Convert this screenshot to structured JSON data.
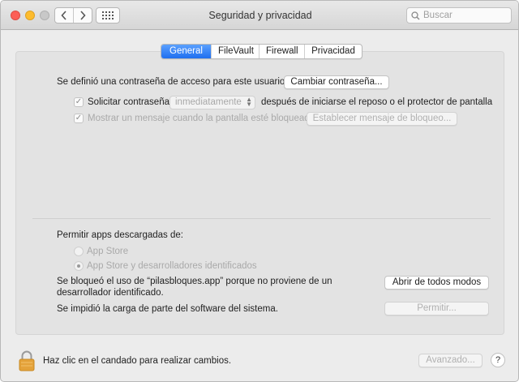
{
  "window": {
    "title": "Seguridad y privacidad",
    "search_placeholder": "Buscar"
  },
  "tabs": [
    {
      "label": "General",
      "active": true
    },
    {
      "label": "FileVault",
      "active": false
    },
    {
      "label": "Firewall",
      "active": false
    },
    {
      "label": "Privacidad",
      "active": false
    }
  ],
  "general": {
    "password_set_text": "Se definió una contraseña de acceso para este usuario",
    "change_password_button": "Cambiar contraseña...",
    "require_password": {
      "label": "Solicitar contraseña",
      "checked": true,
      "select_value": "inmediatamente",
      "suffix": "después de iniciarse el reposo o el protector de pantalla"
    },
    "show_message": {
      "label": "Mostrar un mensaje cuando la pantalla esté bloqueada",
      "checked": true,
      "button": "Establecer mensaje de bloqueo..."
    }
  },
  "downloads": {
    "heading": "Permitir apps descargadas de:",
    "options": [
      {
        "label": "App Store",
        "selected": false
      },
      {
        "label": "App Store y desarrolladores identificados",
        "selected": true
      }
    ],
    "blocked_message": "Se bloqueó el uso de “pilasbloques.app” porque no proviene de un desarrollador identificado.",
    "blocked_line1": "Se bloqueó el uso de “pilasbloques.app” porque no proviene de un",
    "blocked_line2": "desarrollador identificado.",
    "open_anyway_button": "Abrir de todos modos",
    "system_software_text": "Se impidió la carga de parte del software del sistema.",
    "allow_button": "Permitir..."
  },
  "footer": {
    "lock_text": "Haz clic en el candado para realizar cambios.",
    "advanced_button": "Avanzado...",
    "help_button": "?"
  },
  "colors": {
    "accent": "#1f6fef",
    "lock": "#e0a030"
  }
}
